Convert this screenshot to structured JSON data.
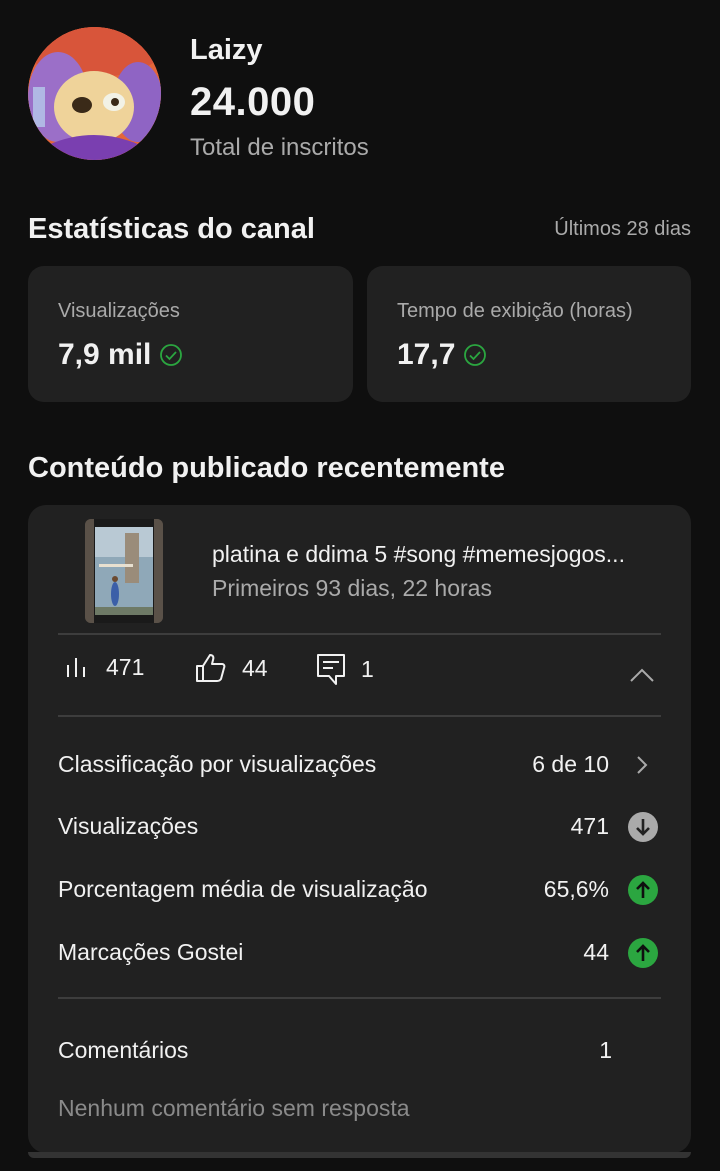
{
  "channel": {
    "name": "Laizy",
    "subscribers": "24.000",
    "subscribers_label": "Total de inscritos"
  },
  "stats": {
    "title": "Estatísticas do canal",
    "period": "Últimos 28 dias",
    "cards": [
      {
        "label": "Visualizações",
        "value": "7,9 mil"
      },
      {
        "label": "Tempo de exibição (horas)",
        "value": "17,7"
      }
    ]
  },
  "recent": {
    "title": "Conteúdo publicado recentemente",
    "video": {
      "title": "platina e ddima 5 #song #memesjogos...",
      "subtitle": "Primeiros 93 dias, 22 horas",
      "views": "471",
      "likes": "44",
      "comments": "1"
    },
    "rows": [
      {
        "label": "Classificação por visualizações",
        "value": "6 de 10",
        "icon": "chevron-right-icon"
      },
      {
        "label": "Visualizações",
        "value": "471",
        "icon": "arrow-down-circle-icon"
      },
      {
        "label": "Porcentagem média de visualização",
        "value": "65,6%",
        "icon": "arrow-up-circle-icon"
      },
      {
        "label": "Marcações Gostei",
        "value": "44",
        "icon": "arrow-up-circle-icon"
      }
    ],
    "comments_label": "Comentários",
    "comments_value": "1",
    "no_reply_text": "Nenhum comentário sem resposta"
  },
  "colors": {
    "background": "#0f0f0f",
    "card": "#212121",
    "positive": "#2ba640",
    "neutral_icon": "#aaaaaa"
  }
}
